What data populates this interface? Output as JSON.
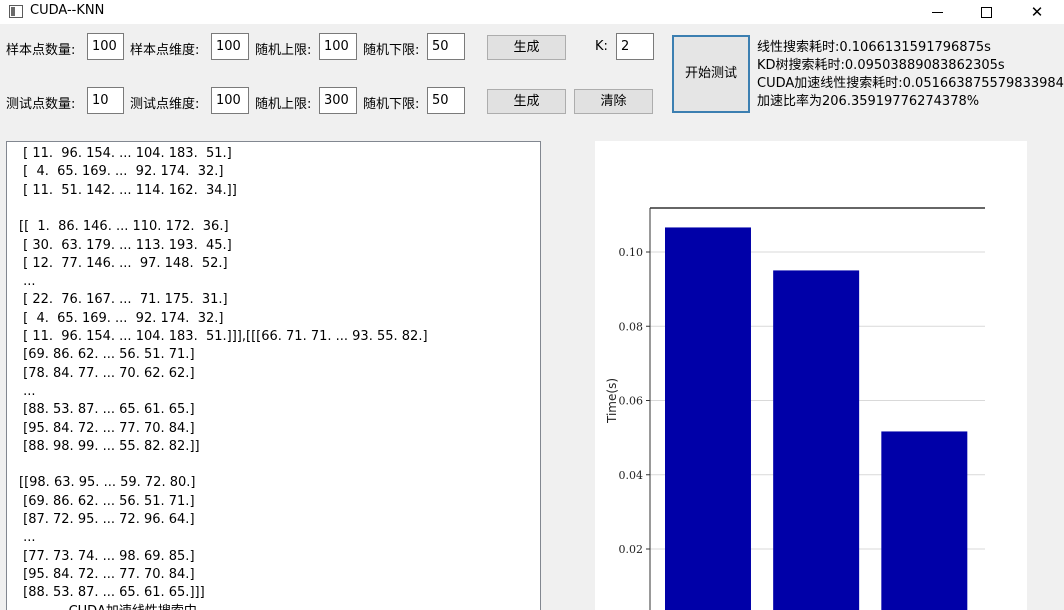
{
  "window": {
    "title": "CUDA--KNN",
    "minimize_glyph": "",
    "close_glyph": "✕"
  },
  "sample_row": {
    "count_label": "样本点数量:",
    "count_value": "100",
    "dim_label": "样本点维度:",
    "dim_value": "100",
    "upper_label": "随机上限:",
    "upper_value": "100",
    "lower_label": "随机下限:",
    "lower_value": "50",
    "generate_label": "生成",
    "k_label": "K:",
    "k_value": "2"
  },
  "test_row": {
    "count_label": "测试点数量:",
    "count_value": "10",
    "dim_label": "测试点维度:",
    "dim_value": "100",
    "upper_label": "随机上限:",
    "upper_value": "300",
    "lower_label": "随机下限:",
    "lower_value": "50",
    "generate_label": "生成",
    "clear_label": "清除"
  },
  "start_button_label": "开始测试",
  "timing": {
    "linear": "线性搜索耗时:0.1066131591796875s",
    "kd": "KD树搜索耗时:0.09503889083862305s",
    "cuda": "CUDA加速线性搜索耗时:0.051663875579833984s",
    "speedup": "加速比率为206.35919776274378%"
  },
  "output_lines": [
    " [ 11.  96. 154. ... 104. 183.  51.]",
    " [  4.  65. 169. ...  92. 174.  32.]",
    " [ 11.  51. 142. ... 114. 162.  34.]]",
    "",
    "[[  1.  86. 146. ... 110. 172.  36.]",
    " [ 30.  63. 179. ... 113. 193.  45.]",
    " [ 12.  77. 146. ...  97. 148.  52.]",
    " ...",
    " [ 22.  76. 167. ...  71. 175.  31.]",
    " [  4.  65. 169. ...  92. 174.  32.]",
    " [ 11.  96. 154. ... 104. 183.  51.]]],[[[66. 71. 71. ... 93. 55. 82.]",
    " [69. 86. 62. ... 56. 51. 71.]",
    " [78. 84. 77. ... 70. 62. 62.]",
    " ...",
    " [88. 53. 87. ... 65. 61. 65.]",
    " [95. 84. 72. ... 77. 70. 84.]",
    " [88. 98. 99. ... 55. 82. 82.]]",
    "",
    "[[98. 63. 95. ... 59. 72. 80.]",
    " [69. 86. 62. ... 56. 51. 71.]",
    " [87. 72. 95. ... 72. 96. 64.]",
    " ...",
    " [77. 73. 74. ... 98. 69. 85.]",
    " [95. 84. 72. ... 77. 70. 84.]",
    " [88. 53. 87. ... 65. 61. 65.]]]",
    "            CUDA加速线性搜索中..."
  ],
  "colors": {
    "bar": "#0000a8",
    "window_bg": "#f0f0f0",
    "start_border": "#3c7fb1"
  },
  "chart_data": {
    "type": "bar",
    "categories": [
      "",
      "",
      ""
    ],
    "values": [
      0.1066131591796875,
      0.09503889083862305,
      0.051663875579833984
    ],
    "ylabel": "Time(s)",
    "yticks": [
      0.02,
      0.04,
      0.06,
      0.08,
      0.1
    ],
    "ytick_labels": [
      "0.02",
      "0.04",
      "0.06",
      "0.08",
      "0.10"
    ],
    "ylim": [
      0.0,
      0.1095
    ],
    "grid": "horizontal",
    "color": "#0000a8"
  }
}
